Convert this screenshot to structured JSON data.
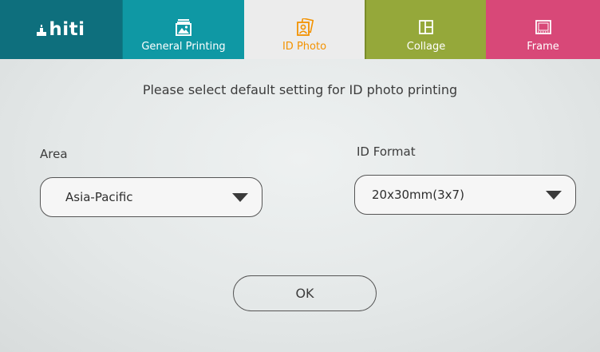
{
  "brand": {
    "logo_text": "hiti"
  },
  "tabs": [
    {
      "label": "General Printing",
      "icon": "image-print-icon",
      "color": "#0f98a4"
    },
    {
      "label": "ID Photo",
      "icon": "id-photo-icon",
      "color": "#f39200",
      "selected": true
    },
    {
      "label": "Collage",
      "icon": "collage-icon",
      "color": "#95a83a"
    },
    {
      "label": "Frame",
      "icon": "frame-icon",
      "color": "#d84878"
    }
  ],
  "main": {
    "prompt": "Please select default setting for ID photo printing",
    "area": {
      "label": "Area",
      "value": "Asia-Pacific"
    },
    "id_format": {
      "label": "ID Format",
      "value": "20x30mm(3x7)"
    },
    "ok_label": "OK"
  },
  "colors": {
    "brand_teal": "#0e6f7d",
    "selected_orange": "#f39200"
  }
}
